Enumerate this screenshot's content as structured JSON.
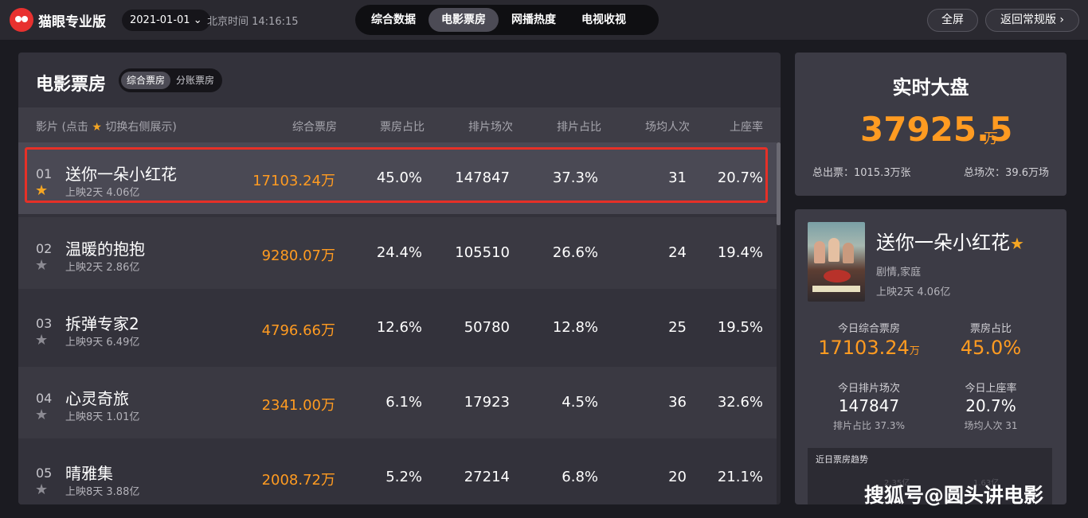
{
  "header": {
    "logo_text": "猫眼专业版",
    "date": "2021-01-01",
    "date_chevron": "⌄",
    "time_label": "北京时间 14:16:15",
    "nav_tabs": [
      "综合数据",
      "电影票房",
      "网播热度",
      "电视收视"
    ],
    "active_tab": "电影票房",
    "fullscreen_label": "全屏",
    "return_label": "返回常规版",
    "return_chevron": "›"
  },
  "panel": {
    "title": "电影票房",
    "toggle": [
      "综合票房",
      "分账票房"
    ],
    "toggle_active": "综合票房",
    "columns": {
      "film": "影片 (点击",
      "film_star": "★",
      "film_suffix": "切换右侧展示)",
      "box": "综合票房",
      "share": "票房占比",
      "shows": "排片场次",
      "show_share": "排片占比",
      "avg": "场均人次",
      "occ": "上座率"
    },
    "rows": [
      {
        "rank": "01",
        "name": "送你一朵小红花",
        "info": "上映2天  4.06亿",
        "box": "17103.24万",
        "share": "45.0%",
        "shows": "147847",
        "show_share": "37.3%",
        "avg": "31",
        "occ": "20.7%",
        "starred": true
      },
      {
        "rank": "02",
        "name": "温暖的抱抱",
        "info": "上映2天  2.86亿",
        "box": "9280.07万",
        "share": "24.4%",
        "shows": "105510",
        "show_share": "26.6%",
        "avg": "24",
        "occ": "19.4%",
        "starred": false
      },
      {
        "rank": "03",
        "name": "拆弹专家2",
        "info": "上映9天  6.49亿",
        "box": "4796.66万",
        "share": "12.6%",
        "shows": "50780",
        "show_share": "12.8%",
        "avg": "25",
        "occ": "19.5%",
        "starred": false
      },
      {
        "rank": "04",
        "name": "心灵奇旅",
        "info": "上映8天  1.01亿",
        "box": "2341.00万",
        "share": "6.1%",
        "shows": "17923",
        "show_share": "4.5%",
        "avg": "36",
        "occ": "32.6%",
        "starred": false
      },
      {
        "rank": "05",
        "name": "晴雅集",
        "info": "上映8天  3.88亿",
        "box": "2008.72万",
        "share": "5.2%",
        "shows": "27214",
        "show_share": "6.8%",
        "avg": "20",
        "occ": "21.1%",
        "starred": false
      }
    ],
    "star_glyph": "★"
  },
  "realtime": {
    "title": "实时大盘",
    "value": "37925.5",
    "unit": "万",
    "total_tickets": "总出票：1015.3万张",
    "total_shows": "总场次：39.6万场"
  },
  "detail": {
    "title": "送你一朵小红花",
    "star": "★",
    "genre": "剧情,家庭",
    "release": "上映2天  4.06亿",
    "today_box_label": "今日综合票房",
    "today_box_value": "17103.24",
    "today_box_unit": "万",
    "share_label": "票房占比",
    "share_value": "45.0%",
    "shows_label": "今日排片场次",
    "shows_value": "147847",
    "shows_sub": "排片占比 37.3%",
    "occ_label": "今日上座率",
    "occ_value": "20.7%",
    "occ_sub": "场均人次 31",
    "trend_title": "近日票房趋势",
    "trend_v1": "2.35亿",
    "trend_v2": "1.63亿"
  },
  "watermark": "搜狐号@圆头讲电影",
  "colors": {
    "accent": "#ff9b21",
    "star": "#f5a623",
    "highlight": "#e63027"
  }
}
